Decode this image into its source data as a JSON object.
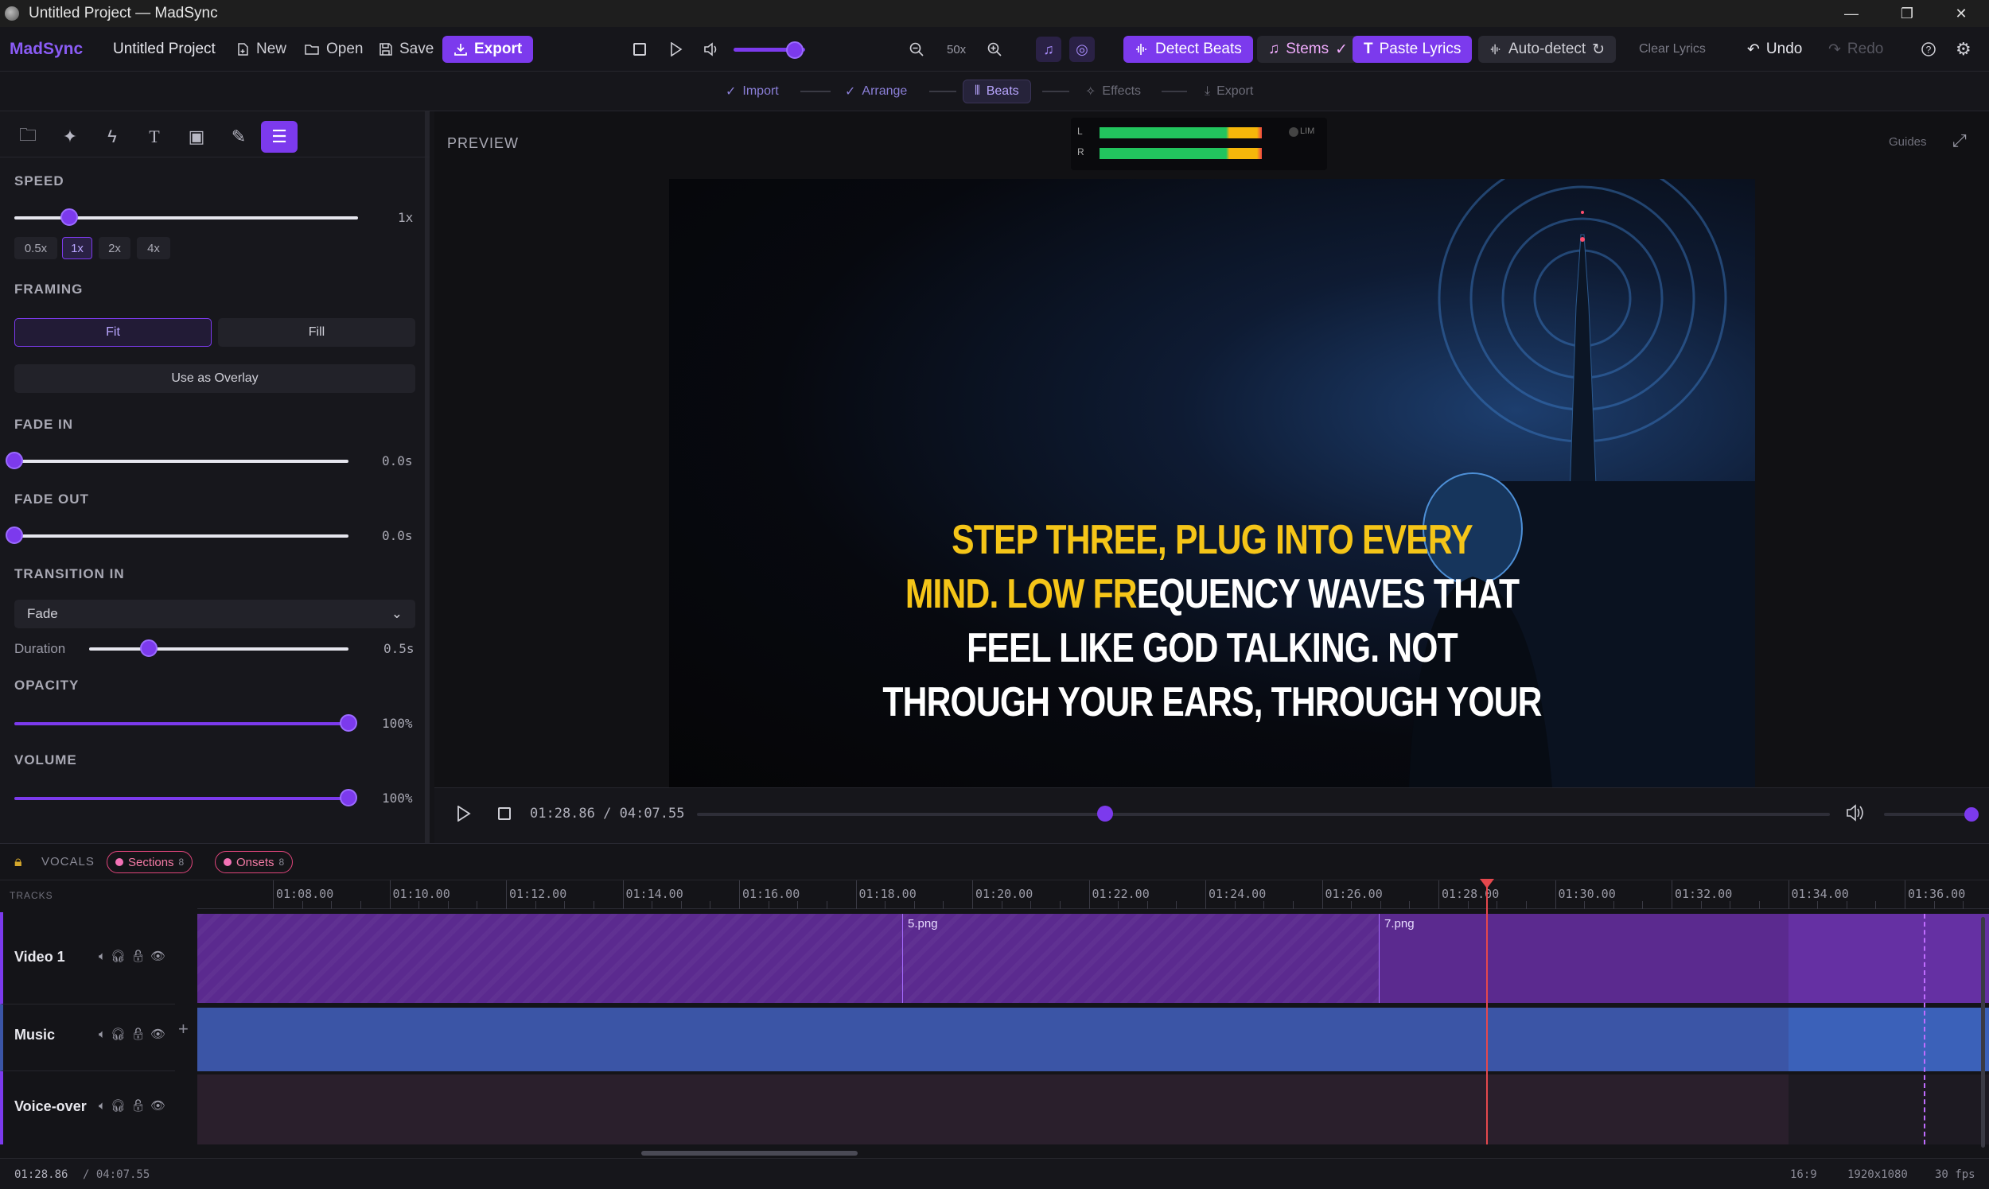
{
  "window": {
    "title": "Untitled Project — MadSync",
    "minimize": "—",
    "restore": "❐",
    "close": "✕"
  },
  "toolbar": {
    "brand": "MadSync",
    "project": "Untitled Project",
    "new_label": "New",
    "open_label": "Open",
    "save_label": "Save",
    "export_label": "Export",
    "zoom_value": "50x",
    "detect_beats": "Detect Beats",
    "stems": "Stems",
    "paste_lyrics": "Paste Lyrics",
    "auto_detect": "Auto-detect",
    "clear_lyrics": "Clear Lyrics",
    "undo": "Undo",
    "redo": "Redo",
    "master_volume": 0.85
  },
  "steps": [
    {
      "label": "Import",
      "state": "done"
    },
    {
      "label": "Arrange",
      "state": "done"
    },
    {
      "label": "Beats",
      "state": "active"
    },
    {
      "label": "Effects",
      "state": "pending"
    },
    {
      "label": "Export",
      "state": "pending"
    }
  ],
  "panel": {
    "speed": {
      "title": "SPEED",
      "value": "1x",
      "level": 0.16,
      "presets": [
        "0.5x",
        "1x",
        "2x",
        "4x"
      ],
      "selected": "1x"
    },
    "framing": {
      "title": "FRAMING",
      "fit": "Fit",
      "fill": "Fill",
      "selected": "Fit",
      "overlay": "Use as Overlay"
    },
    "fade_in": {
      "title": "FADE IN",
      "value": "0.0s",
      "level": 0
    },
    "fade_out": {
      "title": "FADE OUT",
      "value": "0.0s",
      "level": 0
    },
    "transition": {
      "title": "TRANSITION IN",
      "selected": "Fade",
      "duration_label": "Duration",
      "duration_value": "0.5s",
      "level": 0.23
    },
    "opacity": {
      "title": "OPACITY",
      "value": "100%",
      "level": 1
    },
    "volume": {
      "title": "VOLUME",
      "value": "100%",
      "level": 1
    }
  },
  "preview": {
    "title": "PREVIEW",
    "guides": "Guides",
    "meter": {
      "left": "L",
      "right": "R",
      "lim": "LIM",
      "left_level": 0.88,
      "right_level": 0.88
    },
    "caption": {
      "highlighted": [
        "STEP THREE, PLUG INTO EVERY",
        "MIND. LOW FR"
      ],
      "normal": [
        "EQUENCY WAVES THAT",
        "FEEL LIKE GOD TALKING. NOT",
        "THROUGH YOUR EARS, THROUGH YOUR"
      ]
    },
    "time_current": "01:28.86",
    "time_total": "04:07.55",
    "progress": 0.36,
    "volume_level": 1
  },
  "timeline": {
    "lock_label": "VOCALS",
    "sections_label": "Sections",
    "sections_count": "8",
    "onsets_label": "Onsets",
    "onsets_count": "8",
    "tracks_header": "TRACKS",
    "ruler": [
      "01:08.00",
      "01:10.00",
      "01:12.00",
      "01:14.00",
      "01:16.00",
      "01:18.00",
      "01:20.00",
      "01:22.00",
      "01:24.00",
      "01:26.00",
      "01:28.00",
      "01:30.00",
      "01:32.00",
      "01:34.00",
      "01:36.00"
    ],
    "tracks": [
      {
        "name": "Video 1",
        "clips": [
          "5.png",
          "7.png"
        ]
      },
      {
        "name": "Music"
      },
      {
        "name": "Voice-over"
      }
    ],
    "add_track": "+"
  },
  "status": {
    "time_current": "01:28.86",
    "time_total": "/ 04:07.55",
    "aspect": "16:9",
    "resolution": "1920x1080",
    "fps": "30 fps"
  },
  "colors": {
    "accent": "#7c3aed",
    "caption_highlight": "#f5c518",
    "playhead": "#e5484d",
    "video_track": "#5b2a8f",
    "music_track": "#3b55a6"
  }
}
